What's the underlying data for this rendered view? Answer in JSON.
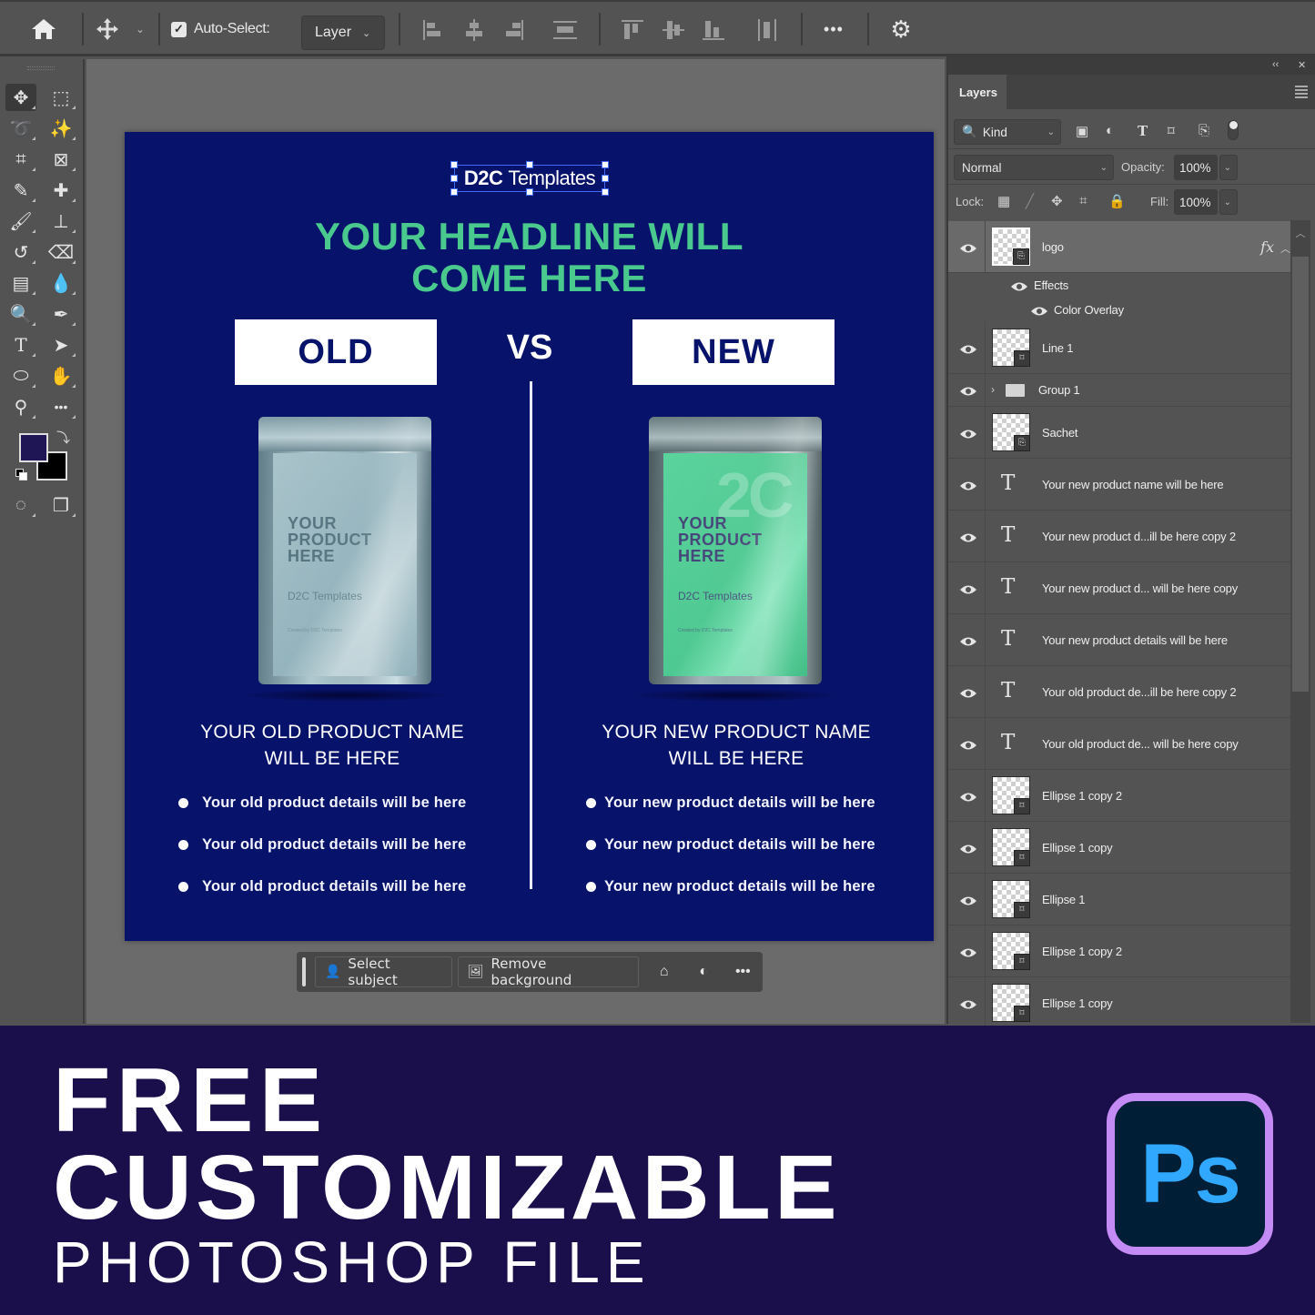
{
  "options_bar": {
    "home_icon": "home-icon",
    "move_tool_icon": "move-icon",
    "auto_select_checked": true,
    "auto_select_label": "Auto-Select:",
    "auto_select_target": "Layer",
    "align_icons": [
      "align-left-edges",
      "align-horizontal-centers",
      "align-right-edges",
      "distribute-vertical",
      "align-top-edges",
      "align-vertical-centers",
      "align-bottom-edges",
      "distribute-horizontal"
    ],
    "more_label": "•••",
    "settings_icon": "gear-icon"
  },
  "toolbar": {
    "tools": [
      {
        "name": "move-tool",
        "glyph": "✥",
        "active": true
      },
      {
        "name": "rectangular-marquee-tool",
        "glyph": "⬚"
      },
      {
        "name": "lasso-tool",
        "glyph": "➰"
      },
      {
        "name": "magic-wand-tool",
        "glyph": "✨"
      },
      {
        "name": "crop-tool",
        "glyph": "⌗"
      },
      {
        "name": "frame-tool",
        "glyph": "⊠"
      },
      {
        "name": "eyedropper-tool",
        "glyph": "✎"
      },
      {
        "name": "healing-brush-tool",
        "glyph": "✚"
      },
      {
        "name": "brush-tool",
        "glyph": "🖌"
      },
      {
        "name": "clone-stamp-tool",
        "glyph": "⊥"
      },
      {
        "name": "history-brush-tool",
        "glyph": "↺"
      },
      {
        "name": "eraser-tool",
        "glyph": "⌫"
      },
      {
        "name": "gradient-tool",
        "glyph": "▤"
      },
      {
        "name": "blur-tool",
        "glyph": "💧"
      },
      {
        "name": "dodge-tool",
        "glyph": "🔍"
      },
      {
        "name": "pen-tool",
        "glyph": "✒"
      },
      {
        "name": "type-tool",
        "glyph": "T"
      },
      {
        "name": "path-selection-tool",
        "glyph": "➤"
      },
      {
        "name": "ellipse-tool",
        "glyph": "⬭"
      },
      {
        "name": "hand-tool",
        "glyph": "✋"
      },
      {
        "name": "zoom-tool",
        "glyph": "⚲"
      },
      {
        "name": "edit-toolbar",
        "glyph": "•••"
      },
      {
        "name": "quick-mask-mode",
        "glyph": "◌"
      },
      {
        "name": "screen-mode",
        "glyph": "❐"
      }
    ],
    "foreground_color": "#1f1656",
    "background_color": "#000000"
  },
  "artboard": {
    "background_color": "#07126a",
    "logo_text": "Templates",
    "logo_mark": "D2C",
    "headline_line1": "YOUR HEADLINE WILL",
    "headline_line2": "COME HERE",
    "headline_color": "#49c98e",
    "old_tag": "OLD",
    "vs_label": "VS",
    "new_tag": "NEW",
    "old_product": {
      "sachet_text_line1": "YOUR",
      "sachet_text_line2": "PRODUCT",
      "sachet_text_line3": "HERE",
      "sachet_brand": "D2C Templates",
      "sachet_created": "Created by D2C Templates",
      "sachet_color": "#8fb3bd",
      "name_line1": "YOUR OLD PRODUCT NAME",
      "name_line2": "WILL BE HERE",
      "details": [
        "Your old product details will be here",
        "Your old product details will be here",
        "Your old product details will be here"
      ]
    },
    "new_product": {
      "sachet_text_line1": "YOUR",
      "sachet_text_line2": "PRODUCT",
      "sachet_text_line3": "HERE",
      "sachet_brand": "D2C Templates",
      "sachet_created": "Created by D2C Templates",
      "sachet_color": "#4fcc94",
      "name_line1": "YOUR NEW PRODUCT NAME",
      "name_line2": "WILL BE HERE",
      "details": [
        "Your new product details will be here",
        "Your new product details will be here",
        "Your new product details will be here"
      ]
    }
  },
  "contextual_taskbar": {
    "select_subject": "Select subject",
    "remove_background": "Remove background",
    "more_label": "•••"
  },
  "layers_panel": {
    "collapse_label": "‹‹",
    "close_label": "✕",
    "tab_label": "Layers",
    "filter_kind": "Kind",
    "blend_mode": "Normal",
    "opacity_label": "Opacity:",
    "opacity_value": "100%",
    "lock_label": "Lock:",
    "fill_label": "Fill:",
    "fill_value": "100%",
    "layers": [
      {
        "name": "logo",
        "type": "smart",
        "selected": true,
        "fx": true
      },
      {
        "name": "Effects",
        "type": "effects-header"
      },
      {
        "name": "Color Overlay",
        "type": "effect"
      },
      {
        "name": "Line 1",
        "type": "shape"
      },
      {
        "name": "Group 1",
        "type": "group"
      },
      {
        "name": "Sachet",
        "type": "smart"
      },
      {
        "name": "Your new product name  will be here",
        "type": "text"
      },
      {
        "name": "Your new product d...ill be here copy 2",
        "type": "text"
      },
      {
        "name": "Your new product d... will be here copy",
        "type": "text"
      },
      {
        "name": "Your new product details will be here",
        "type": "text"
      },
      {
        "name": "Your old product de...ill be here copy 2",
        "type": "text"
      },
      {
        "name": "Your old product de... will be here copy",
        "type": "text"
      },
      {
        "name": "Ellipse 1 copy 2",
        "type": "shape"
      },
      {
        "name": "Ellipse 1 copy",
        "type": "shape"
      },
      {
        "name": "Ellipse 1",
        "type": "shape"
      },
      {
        "name": "Ellipse 1 copy 2",
        "type": "shape"
      },
      {
        "name": "Ellipse 1 copy",
        "type": "shape"
      }
    ]
  },
  "banner": {
    "line1": "FREE",
    "line2": "CUSTOMIZABLE",
    "line3": "PHOTOSHOP FILE",
    "app_logo_text": "Ps",
    "background_color": "#1b0f4b",
    "logo_border_color": "#c58bf5",
    "logo_bg_color": "#001e36",
    "logo_text_color": "#31a8ff"
  }
}
